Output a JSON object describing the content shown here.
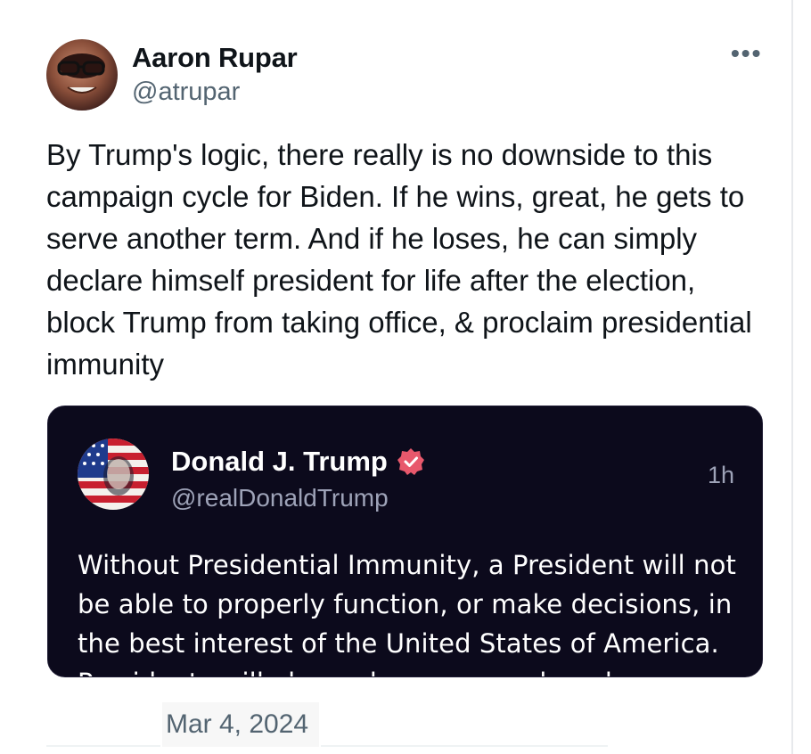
{
  "tweet": {
    "author_name": "Aaron Rupar",
    "author_handle": "@atrupar",
    "more_icon": "•••",
    "text": "By Trump's logic, there really is no downside to this campaign cycle for Biden. If he wins, great, he gets to serve another term. And if he loses, he can simply declare himself president for life after the election, block Trump from taking office, & proclaim presidential immunity",
    "date": "Mar 4, 2024"
  },
  "quoted_post": {
    "author_name": "Donald J. Trump",
    "author_handle": "@realDonaldTrump",
    "time": "1h",
    "verified_badge_color": "#e8586c",
    "text": "Without Presidential Immunity, a President will not be able to properly function, or make decisions, in the best interest of the United States of America. Presidents will always be concerned, and even"
  },
  "colors": {
    "quote_background": "#0c0a1c",
    "primary_text": "#0f1419",
    "secondary_text": "#536471"
  }
}
